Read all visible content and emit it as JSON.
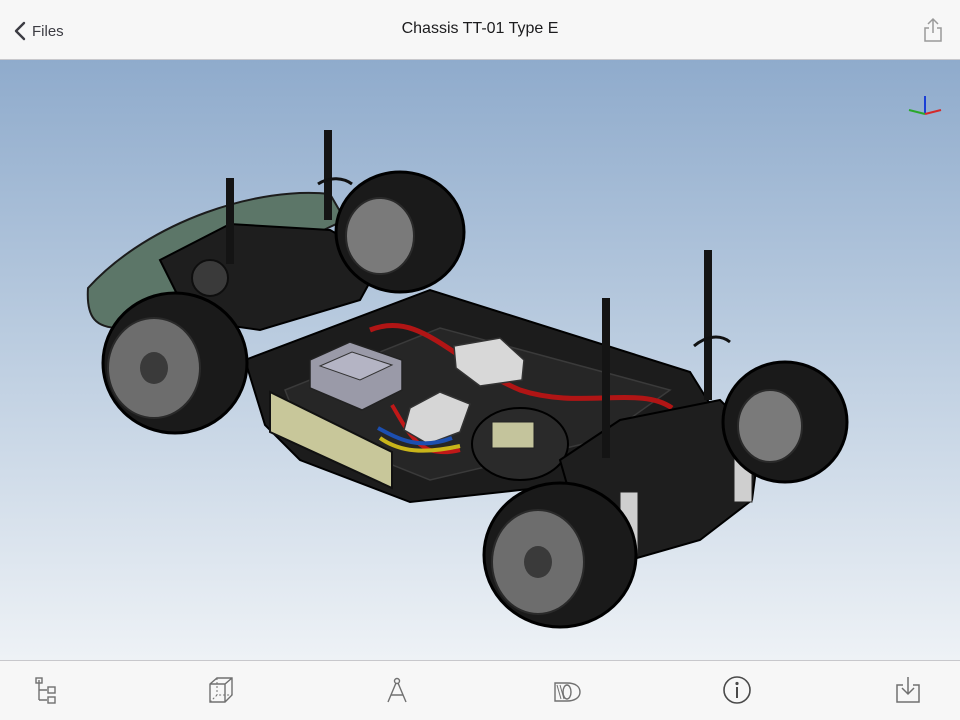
{
  "nav": {
    "back_label": "Files",
    "title": "Chassis TT-01 Type E"
  },
  "icons": {
    "back": "chevron-left-icon",
    "share": "share-icon",
    "triad": "axis-triad-icon",
    "toolbar": [
      "tree-icon",
      "wireframe-cube-icon",
      "measure-icon",
      "section-icon",
      "info-icon",
      "download-icon"
    ]
  },
  "colors": {
    "viewport_top": "#8fabcc",
    "viewport_bottom": "#eef2f6",
    "bar_background": "#f7f7f7",
    "icon_gray": "#707070"
  },
  "viewport": {
    "content": "3D model of RC car chassis"
  }
}
